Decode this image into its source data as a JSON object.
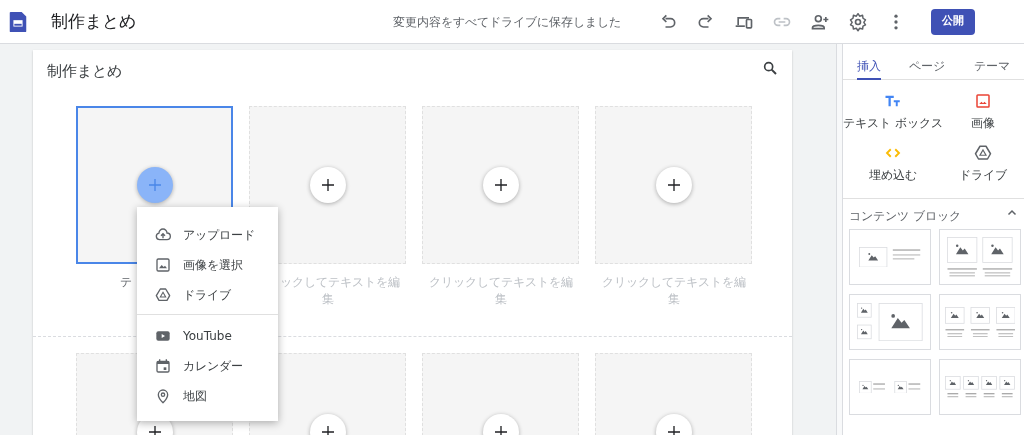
{
  "app": {
    "title": "制作まとめ",
    "save_status": "変更内容をすべてドライブに保存しました",
    "publish_button": "公開"
  },
  "toolbar": [
    {
      "kind": "undo",
      "disabled": false
    },
    {
      "kind": "redo",
      "disabled": false
    },
    {
      "kind": "preview",
      "disabled": false
    },
    {
      "kind": "link",
      "disabled": true
    },
    {
      "kind": "share",
      "disabled": false
    },
    {
      "kind": "settings",
      "disabled": false
    },
    {
      "kind": "more",
      "disabled": false
    }
  ],
  "page": {
    "title": "制作まとめ",
    "sections": [
      {
        "tiles": [
          {
            "selected": true,
            "caption": [
              "テ"
            ]
          },
          {
            "selected": false,
            "caption": [
              "ックしてテキストを編",
              "集"
            ]
          },
          {
            "selected": false,
            "caption": [
              "クリックしてテキストを編",
              "集"
            ]
          },
          {
            "selected": false,
            "caption": [
              "クリックしてテキストを編",
              "集"
            ]
          }
        ]
      },
      {
        "tiles": [
          {
            "selected": false
          },
          {
            "selected": false
          },
          {
            "selected": false
          },
          {
            "selected": false
          }
        ]
      }
    ]
  },
  "insert_menu": {
    "groups": [
      [
        {
          "kind": "upload",
          "label": "アップロード"
        },
        {
          "kind": "image",
          "label": "画像を選択"
        },
        {
          "kind": "drive",
          "label": "ドライブ"
        }
      ],
      [
        {
          "kind": "youtube",
          "label": "YouTube"
        },
        {
          "kind": "calendar",
          "label": "カレンダー"
        },
        {
          "kind": "map",
          "label": "地図"
        }
      ]
    ]
  },
  "side_panel": {
    "tabs": [
      {
        "label": "挿入",
        "selected": true
      },
      {
        "label": "ページ",
        "selected": false
      },
      {
        "label": "テーマ",
        "selected": false
      }
    ],
    "insert_items": [
      {
        "kind": "textbox",
        "label": "テキスト ボックス"
      },
      {
        "kind": "image",
        "label": "画像"
      },
      {
        "kind": "embed",
        "label": "埋め込む"
      },
      {
        "kind": "drive",
        "label": "ドライブ"
      }
    ],
    "content_blocks": {
      "title": "コンテンツ ブロック",
      "expanded": true,
      "layouts": [
        {
          "kind": "image-text"
        },
        {
          "kind": "two-columns"
        },
        {
          "kind": "image-collage"
        },
        {
          "kind": "three-columns"
        },
        {
          "kind": "two-image-text"
        },
        {
          "kind": "four-columns"
        }
      ]
    }
  }
}
